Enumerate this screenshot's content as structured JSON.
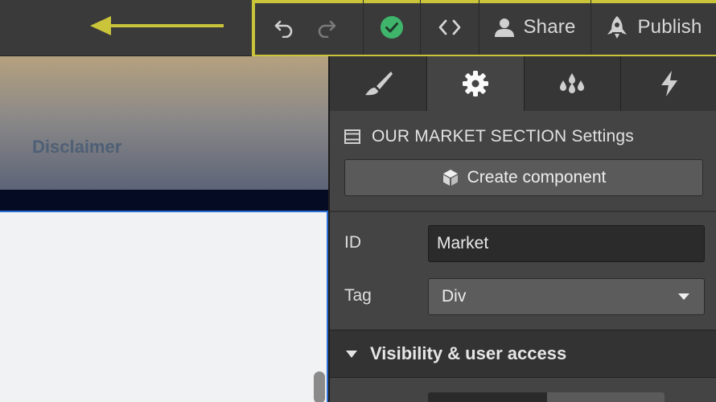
{
  "toolbar": {
    "share_label": "Share",
    "publish_label": "Publish",
    "icons": [
      "undo-icon",
      "redo-icon",
      "check-circle-icon",
      "code-icon",
      "user-icon",
      "rocket-icon"
    ],
    "accent_color": "#c9c43a",
    "status_color": "#3fb46b"
  },
  "canvas": {
    "hero_text": "Disclaimer"
  },
  "panel": {
    "tabs": [
      {
        "name": "style",
        "icon": "paintbrush-icon"
      },
      {
        "name": "settings",
        "icon": "gear-icon",
        "active": true
      },
      {
        "name": "variables",
        "icon": "drops-icon"
      },
      {
        "name": "interactions",
        "icon": "lightning-icon"
      }
    ],
    "section_title": "OUR MARKET SECTION Settings",
    "create_component_label": "Create component",
    "id_label": "ID",
    "id_value": "Market",
    "tag_label": "Tag",
    "tag_value": "Div",
    "visibility_title": "Visibility & user access"
  }
}
